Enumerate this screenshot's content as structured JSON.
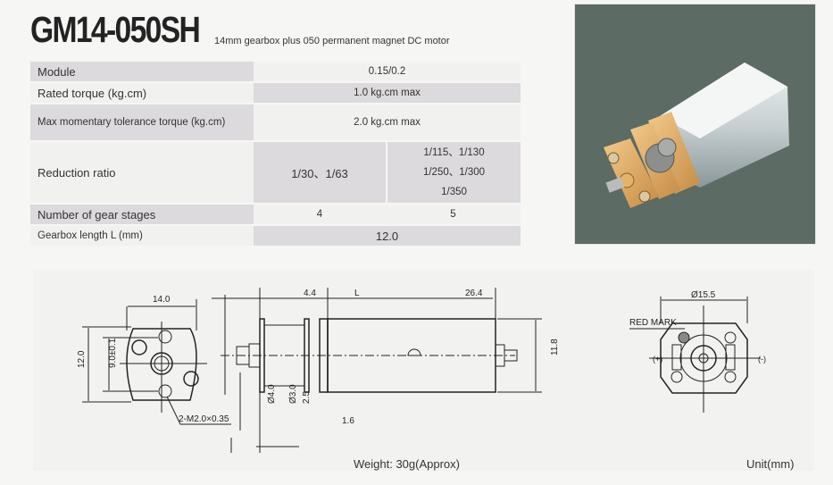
{
  "header": {
    "model": "GM14-050SH",
    "subtitle": "14mm gearbox plus 050 permanent magnet DC  motor"
  },
  "specs": {
    "module": {
      "label": "Module",
      "value": "0.15/0.2"
    },
    "rated_torque": {
      "label": "Rated torque (kg.cm)",
      "value": "1.0 kg.cm max"
    },
    "max_torque": {
      "label": "Max momentary tolerance torque (kg.cm)",
      "value": "2.0 kg.cm max"
    },
    "reduction_ratio": {
      "label": "Reduction ratio",
      "col1": "1/30、1/63",
      "col2_lines": [
        "1/115、1/130",
        "1/250、1/300",
        "1/350"
      ]
    },
    "gear_stages": {
      "label": "Number of gear stages",
      "col1": "4",
      "col2": "5"
    },
    "gearbox_length": {
      "label": "Gearbox length  L (mm)",
      "value": "12.0"
    }
  },
  "photo": {
    "alt": "GM14-050SH gear motor product photo"
  },
  "drawing": {
    "front_view": {
      "width": "14.0",
      "height": "12.0",
      "hole_spacing": "9.0±0.1",
      "thread": "2-M2.0×0.35"
    },
    "side_view": {
      "shaft_length": "4.4",
      "gearbox_length": "L",
      "motor_length": "26.4",
      "motor_height": "11.8",
      "shaft_dia_outer": "Ø4.0",
      "shaft_dia_inner": "Ø3.0",
      "flat": "2.5",
      "boss": "1.6"
    },
    "rear_view": {
      "diameter": "Ø15.5",
      "red_mark": "RED MARK",
      "plus": "(+)",
      "minus": "(-)"
    }
  },
  "footer": {
    "weight": "Weight: 30g(Approx)",
    "unit": "Unit(mm)"
  }
}
